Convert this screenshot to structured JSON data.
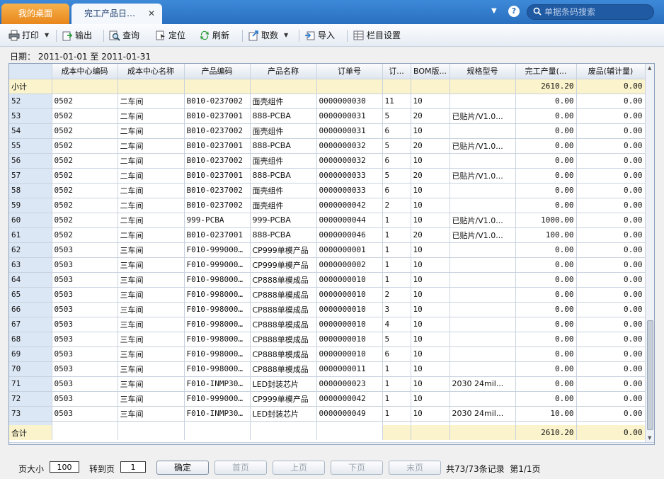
{
  "titlebar": {
    "home_tab": "我的桌面",
    "active_tab": "完工产品日…",
    "close": "✕",
    "search_placeholder": "单据条码搜索"
  },
  "toolbar": {
    "print": "打印",
    "export": "输出",
    "query": "查询",
    "locate": "定位",
    "refresh": "刷新",
    "fetch": "取数",
    "import": "导入",
    "columns": "栏目设置"
  },
  "dateline": {
    "label": "日期：",
    "from": "2011-01-01",
    "to_word": "至",
    "to": "2011-01-31"
  },
  "grid": {
    "headers": [
      "",
      "成本中心编码",
      "成本中心名称",
      "产品编码",
      "产品名称",
      "订单号",
      "订...",
      "BOM版...",
      "规格型号",
      "完工产量(...",
      "废品(辅计量)"
    ],
    "subtotal": {
      "label": "小计",
      "qty": "2610.20",
      "waste": "0.00"
    },
    "rows": [
      [
        "52",
        "0502",
        "二车间",
        "B010-0237002",
        "面壳组件",
        "0000000030",
        "11",
        "10",
        "",
        "0.00",
        "0.00"
      ],
      [
        "53",
        "0502",
        "二车间",
        "B010-0237001",
        "888-PCBA",
        "0000000031",
        "5",
        "20",
        "已贴片/V1.0...",
        "0.00",
        "0.00"
      ],
      [
        "54",
        "0502",
        "二车间",
        "B010-0237002",
        "面壳组件",
        "0000000031",
        "6",
        "10",
        "",
        "0.00",
        "0.00"
      ],
      [
        "55",
        "0502",
        "二车间",
        "B010-0237001",
        "888-PCBA",
        "0000000032",
        "5",
        "20",
        "已贴片/V1.0...",
        "0.00",
        "0.00"
      ],
      [
        "56",
        "0502",
        "二车间",
        "B010-0237002",
        "面壳组件",
        "0000000032",
        "6",
        "10",
        "",
        "0.00",
        "0.00"
      ],
      [
        "57",
        "0502",
        "二车间",
        "B010-0237001",
        "888-PCBA",
        "0000000033",
        "5",
        "20",
        "已贴片/V1.0...",
        "0.00",
        "0.00"
      ],
      [
        "58",
        "0502",
        "二车间",
        "B010-0237002",
        "面壳组件",
        "0000000033",
        "6",
        "10",
        "",
        "0.00",
        "0.00"
      ],
      [
        "59",
        "0502",
        "二车间",
        "B010-0237002",
        "面壳组件",
        "0000000042",
        "2",
        "10",
        "",
        "0.00",
        "0.00"
      ],
      [
        "60",
        "0502",
        "二车间",
        "999-PCBA",
        "999-PCBA",
        "0000000044",
        "1",
        "10",
        "已贴片/V1.0...",
        "1000.00",
        "0.00"
      ],
      [
        "61",
        "0502",
        "二车间",
        "B010-0237001",
        "888-PCBA",
        "0000000046",
        "1",
        "20",
        "已贴片/V1.0...",
        "100.00",
        "0.00"
      ],
      [
        "62",
        "0503",
        "三车间",
        "F010-999000...",
        "CP999单模产品",
        "0000000001",
        "1",
        "10",
        "",
        "0.00",
        "0.00"
      ],
      [
        "63",
        "0503",
        "三车间",
        "F010-999000...",
        "CP999单模产品",
        "0000000002",
        "1",
        "10",
        "",
        "0.00",
        "0.00"
      ],
      [
        "64",
        "0503",
        "三车间",
        "F010-998000...",
        "CP888单模成品",
        "0000000010",
        "1",
        "10",
        "",
        "0.00",
        "0.00"
      ],
      [
        "65",
        "0503",
        "三车间",
        "F010-998000...",
        "CP888单模成品",
        "0000000010",
        "2",
        "10",
        "",
        "0.00",
        "0.00"
      ],
      [
        "66",
        "0503",
        "三车间",
        "F010-998000...",
        "CP888单模成品",
        "0000000010",
        "3",
        "10",
        "",
        "0.00",
        "0.00"
      ],
      [
        "67",
        "0503",
        "三车间",
        "F010-998000...",
        "CP888单模成品",
        "0000000010",
        "4",
        "10",
        "",
        "0.00",
        "0.00"
      ],
      [
        "68",
        "0503",
        "三车间",
        "F010-998000...",
        "CP888单模成品",
        "0000000010",
        "5",
        "10",
        "",
        "0.00",
        "0.00"
      ],
      [
        "69",
        "0503",
        "三车间",
        "F010-998000...",
        "CP888单模成品",
        "0000000010",
        "6",
        "10",
        "",
        "0.00",
        "0.00"
      ],
      [
        "70",
        "0503",
        "三车间",
        "F010-998000...",
        "CP888单模成品",
        "0000000011",
        "1",
        "10",
        "",
        "0.00",
        "0.00"
      ],
      [
        "71",
        "0503",
        "三车间",
        "F010-INMP30DS",
        "LED封装芯片",
        "0000000023",
        "1",
        "10",
        "2030 24mil...",
        "0.00",
        "0.00"
      ],
      [
        "72",
        "0503",
        "三车间",
        "F010-999000...",
        "CP999单模产品",
        "0000000042",
        "1",
        "10",
        "",
        "0.00",
        "0.00"
      ],
      [
        "73",
        "0503",
        "三车间",
        "F010-INMP30DS",
        "LED封装芯片",
        "0000000049",
        "1",
        "10",
        "2030 24mil...",
        "10.00",
        "0.00"
      ]
    ],
    "total": {
      "label": "合计",
      "qty": "2610.20",
      "waste": "0.00"
    }
  },
  "pager": {
    "page_size_label": "页大小",
    "page_size": "100",
    "goto_label": "转到页",
    "goto_page": "1",
    "confirm": "确定",
    "first": "首页",
    "prev": "上页",
    "next": "下页",
    "last": "末页",
    "summary": "共73/73条记录  第1/1页"
  },
  "colors": {
    "titlebar": "#2a6fc0",
    "home_tab": "#e8861c",
    "row_number": "#dce7f5",
    "subtotal": "#fbf3cc"
  }
}
